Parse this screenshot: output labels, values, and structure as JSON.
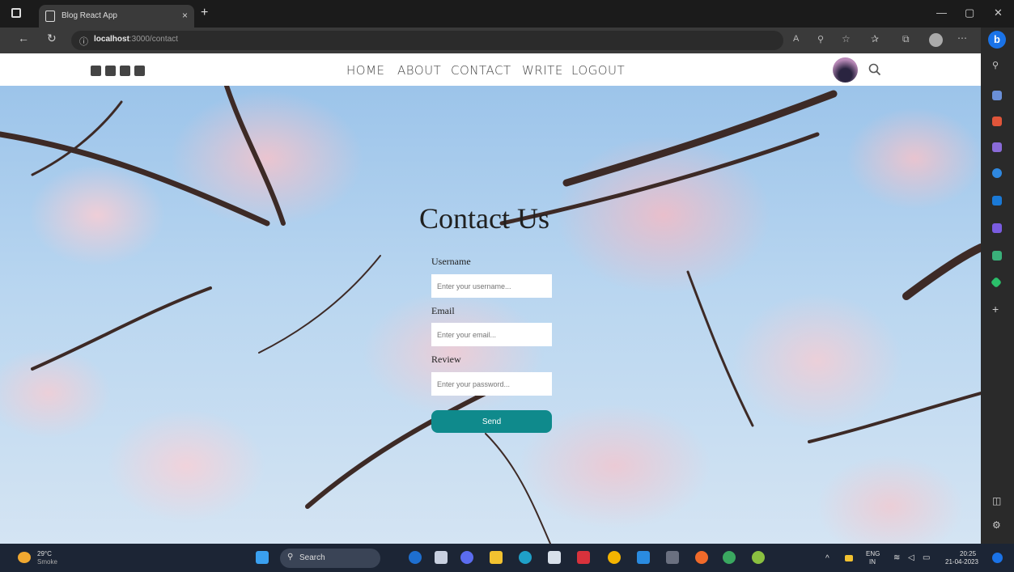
{
  "browser": {
    "tab_title": "Blog React App",
    "url_host": "localhost",
    "url_rest": ":3000/contact",
    "new_tab": "+",
    "close_tab": "×"
  },
  "site": {
    "nav": [
      "HOME",
      "ABOUT",
      "CONTACT",
      "WRITE",
      "LOGOUT"
    ],
    "social_icons": [
      "facebook-icon",
      "twitter-icon",
      "pinterest-icon",
      "instagram-icon"
    ]
  },
  "contact": {
    "title": "Contact Us",
    "username_label": "Username",
    "username_placeholder": "Enter your username...",
    "email_label": "Email",
    "email_placeholder": "Enter your email...",
    "review_label": "Review",
    "review_placeholder": "Enter your password...",
    "send_label": "Send"
  },
  "taskbar": {
    "weather_temp": "29°C",
    "weather_desc": "Smoke",
    "search_label": "Search",
    "lang_top": "ENG",
    "lang_bottom": "IN",
    "time": "20:25",
    "date": "21-04-2023"
  },
  "colors": {
    "accent": "#0f8a8c",
    "taskbar": "#1c2535"
  }
}
